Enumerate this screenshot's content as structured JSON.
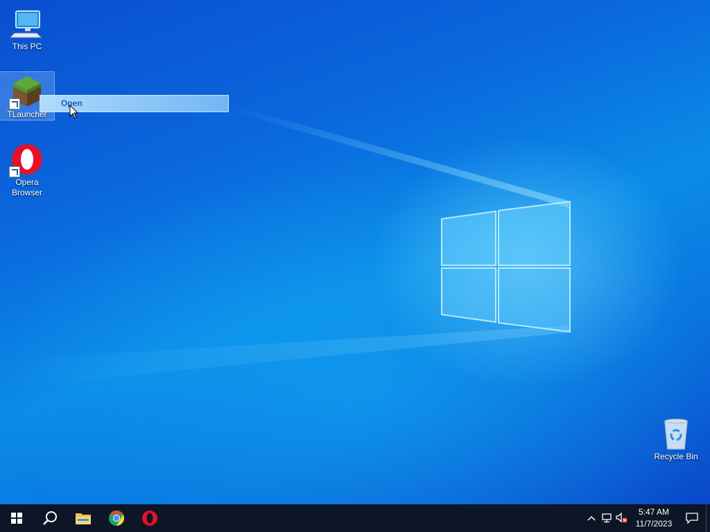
{
  "desktop": {
    "icons": [
      {
        "label": "This PC",
        "icon": "this-pc-icon"
      },
      {
        "label": "TLauncher",
        "icon": "tlauncher-icon"
      },
      {
        "label": "Opera\nBrowser",
        "label_line1": "Opera",
        "label_line2": "Browser",
        "icon": "opera-icon"
      },
      {
        "label": "Recycle Bin",
        "icon": "recycle-bin-icon"
      }
    ],
    "drag_tooltip": "Open"
  },
  "taskbar": {
    "buttons": [
      {
        "name": "start",
        "icon": "windows-logo-icon"
      },
      {
        "name": "search",
        "icon": "search-icon"
      },
      {
        "name": "file-explorer",
        "icon": "folder-icon"
      },
      {
        "name": "chrome",
        "icon": "chrome-icon"
      },
      {
        "name": "opera",
        "icon": "opera-icon"
      }
    ],
    "tray": {
      "icons": [
        "chevron-up-icon",
        "network-icon",
        "volume-muted-icon"
      ],
      "time": "5:47 AM",
      "date": "11/7/2023"
    }
  },
  "colors": {
    "taskbar": "#0c1627",
    "accent": "#0a74df",
    "opera_red": "#e5102a",
    "chrome_green": "#1da462",
    "chrome_yellow": "#ffcd46",
    "chrome_red": "#dd4b39",
    "chrome_blue": "#4c8bf5"
  }
}
